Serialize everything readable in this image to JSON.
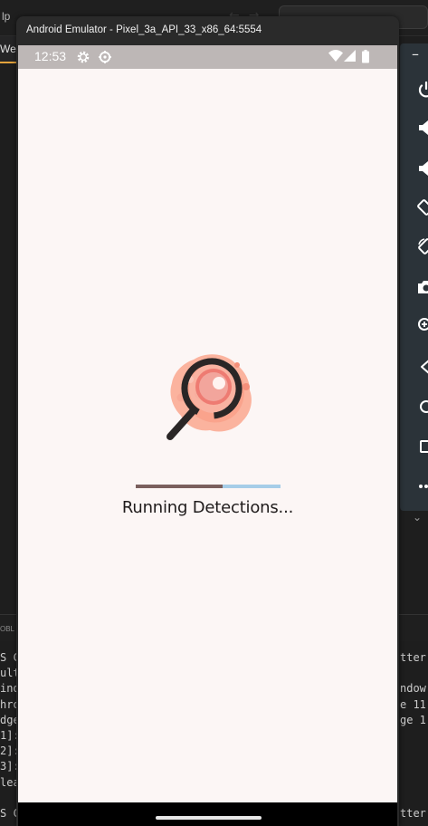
{
  "ide": {
    "menu_fragment": "lp",
    "tab_fragment": "We",
    "panel_fragment": "OBL",
    "terminal_left": [
      "S C",
      "ult",
      "ind",
      "hro",
      "dge",
      "1]:",
      "2]:",
      "3]:",
      "lea",
      "",
      "S C"
    ],
    "terminal_right": [
      "tter",
      "",
      "ndow",
      "e 11",
      "ge 1",
      "",
      "",
      "",
      "",
      "",
      "tter"
    ]
  },
  "emulator": {
    "window_title": "Android Emulator - Pixel_3a_API_33_x86_64:5554",
    "minimize_label": "–",
    "toolbar_items": [
      "power-icon",
      "volume-up-icon",
      "volume-down-icon",
      "rotate-left-icon",
      "rotate-right-icon",
      "camera-icon",
      "zoom-icon",
      "back-icon",
      "home-icon",
      "overview-icon",
      "more-icon"
    ]
  },
  "status_bar": {
    "time": "12:53",
    "icons": [
      "settings-gear-icon",
      "sync-icon",
      "wifi-icon",
      "signal-icon",
      "battery-icon"
    ]
  },
  "app": {
    "loading_text": "Running Detections...",
    "progress_fraction": 0.6,
    "colors": {
      "background": "#fcf6f5",
      "progress_fill": "#7a5f5d",
      "progress_track": "#a6cde8"
    }
  }
}
